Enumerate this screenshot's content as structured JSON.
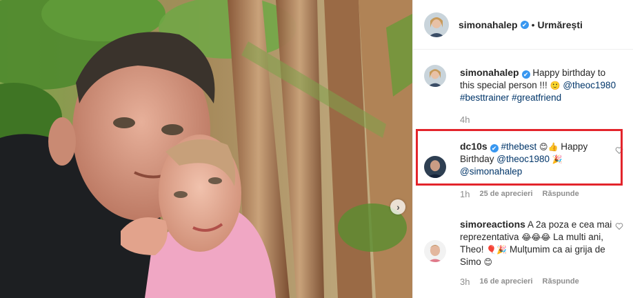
{
  "photo": {
    "next_button_glyph": "›",
    "next_icon": "chevron-right-icon"
  },
  "header": {
    "username": "simonahalep",
    "verified_mark": "✔",
    "separator": "•",
    "follow_label": "Urmărești"
  },
  "caption": {
    "username": "simonahalep",
    "text": "Happy birthday to this special person !!!",
    "emoji": "🙂",
    "mention": "@theoc1980",
    "tags": [
      "#besttrainer",
      "#greatfriend"
    ],
    "time": "4h"
  },
  "comments": [
    {
      "username": "dc10s",
      "tag": "#thebest",
      "emoji1": "😊👍",
      "text1": "Happy Birthday",
      "mention1": "@theoc1980",
      "emoji2": "🎉",
      "mention2": "@simonahalep",
      "time": "1h",
      "likes": "25 de aprecieri",
      "reply": "Răspunde"
    },
    {
      "username": "simoreactions",
      "text1": "A 2a poza e cea mai reprezentativa",
      "emoji1": "😂😂😂",
      "text2": "La multi ani, Theo!",
      "emoji2": "🎈🎉",
      "text3": "Mulțumim ca ai grija de Simo",
      "emoji3": "😊",
      "time": "3h",
      "likes": "16 de aprecieri",
      "reply": "Răspunde"
    }
  ],
  "colors": {
    "verified": "#3897f0",
    "link": "#003569",
    "highlight": "#e3242b",
    "muted": "#8e8e8e"
  }
}
